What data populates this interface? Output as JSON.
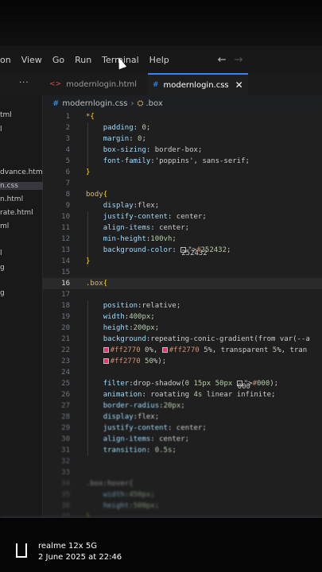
{
  "menu": [
    "on",
    "View",
    "Go",
    "Run",
    "Terminal",
    "Help"
  ],
  "tabs": [
    {
      "label": "modernlogin.html",
      "active": false
    },
    {
      "label": "modernlogin.css",
      "active": true
    }
  ],
  "sidebar": [
    "tml",
    "l",
    "dvance.html",
    "n.css",
    "n.html",
    "rate.html",
    "ml",
    "l",
    "g",
    "g"
  ],
  "breadcrumb": {
    "file": "modernlogin.css",
    "selector": ".box"
  },
  "code": [
    {
      "n": "1",
      "t": "*{"
    },
    {
      "n": "2",
      "t": "    padding: 0;"
    },
    {
      "n": "3",
      "t": "    margin: 0;"
    },
    {
      "n": "4",
      "t": "    box-sizing: border-box;"
    },
    {
      "n": "5",
      "t": "    font-family:'poppins', sans-serif;"
    },
    {
      "n": "6",
      "t": "}"
    },
    {
      "n": "7",
      "t": ""
    },
    {
      "n": "8",
      "t": "body{"
    },
    {
      "n": "9",
      "t": "    display:flex;"
    },
    {
      "n": "10",
      "t": "    justify-content: center;"
    },
    {
      "n": "11",
      "t": "    align-items: center;"
    },
    {
      "n": "12",
      "t": "    min-height:100vh;"
    },
    {
      "n": "13",
      "t": "    background-color: #252432;"
    },
    {
      "n": "14",
      "t": "}"
    },
    {
      "n": "15",
      "t": ""
    },
    {
      "n": "16",
      "t": ".box{"
    },
    {
      "n": "17",
      "t": ""
    },
    {
      "n": "18",
      "t": "    position:relative;"
    },
    {
      "n": "19",
      "t": "    width:400px;"
    },
    {
      "n": "20",
      "t": "    height:200px;"
    },
    {
      "n": "21",
      "t": "    background:repeating-conic-gradient(from var(--a"
    },
    {
      "n": "22",
      "t": "    #ff2770 0%, #ff2770 5%, transparent 5%, tran"
    },
    {
      "n": "23",
      "t": "    #ff2770 50%);"
    },
    {
      "n": "24",
      "t": ""
    },
    {
      "n": "25",
      "t": "    filter:drop-shadow(0 15px 50px #000);"
    },
    {
      "n": "26",
      "t": "    animation: roatating 4s linear infinite;"
    },
    {
      "n": "27",
      "t": "    border-radius:20px;"
    },
    {
      "n": "28",
      "t": "    display:flex;"
    },
    {
      "n": "29",
      "t": "    justify-content: center;"
    },
    {
      "n": "30",
      "t": "    align-items: center;"
    },
    {
      "n": "31",
      "t": "    transition: 0.5s;"
    },
    {
      "n": "32",
      "t": ""
    },
    {
      "n": "33",
      "t": ""
    },
    {
      "n": "34",
      "t": ".box:hover{"
    },
    {
      "n": "35",
      "t": "    width:450px;"
    },
    {
      "n": "36",
      "t": "    height:500px;"
    },
    {
      "n": "37",
      "t": "}"
    }
  ],
  "watermark": {
    "device": "realme 12x 5G",
    "date": "2 June 2025 at 22:46"
  },
  "colors": {
    "accent": "#3b82f6",
    "background": "#252432",
    "pink": "#ff2770"
  }
}
